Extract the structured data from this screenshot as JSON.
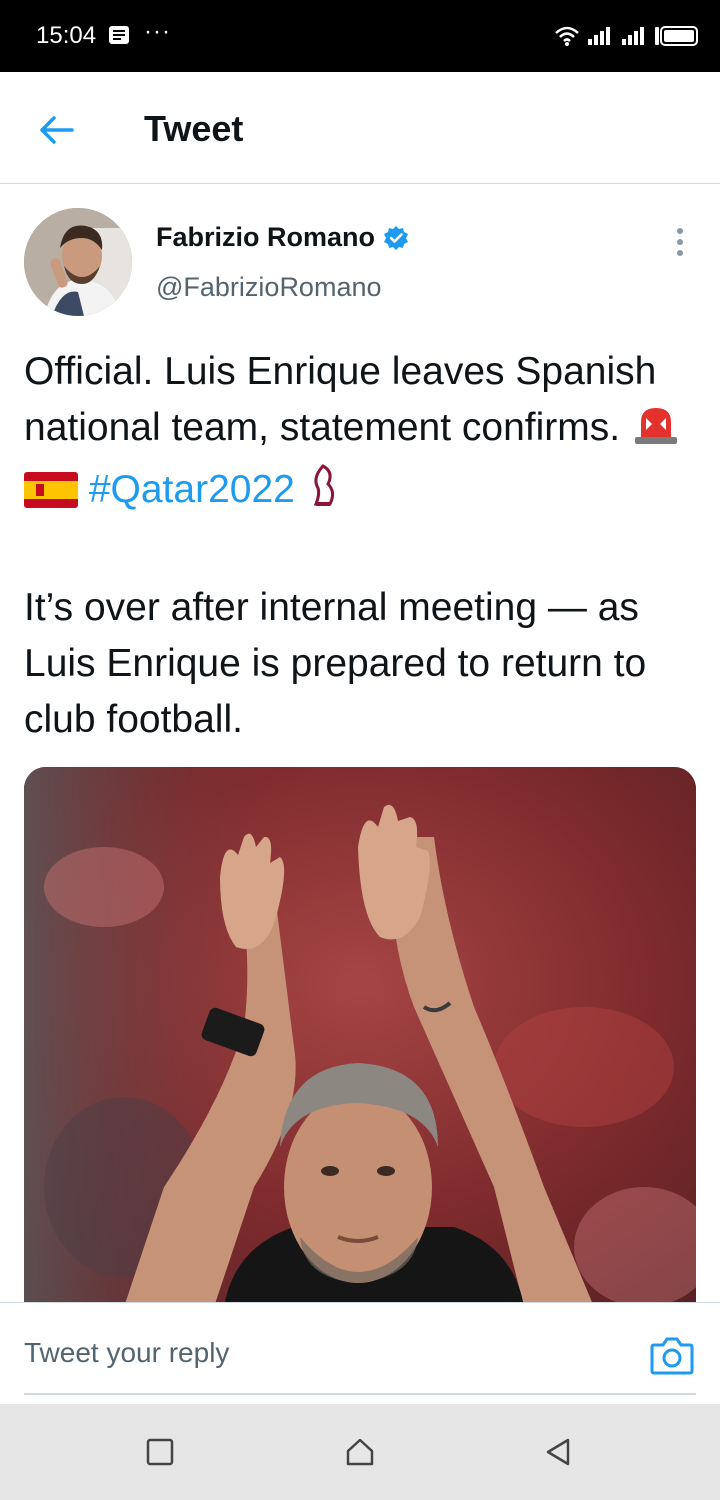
{
  "status_bar": {
    "time": "15:04",
    "more": "···"
  },
  "header": {
    "title": "Tweet"
  },
  "author": {
    "name": "Fabrizio Romano",
    "handle": "@FabrizioRomano",
    "verified": true
  },
  "tweet": {
    "line1": "Official. Luis Enrique leaves Spanish national team, statement confirms.",
    "hashtag": "#Qatar2022",
    "line2": "It’s over after internal meeting — as Luis Enrique is prepared to return to club football."
  },
  "reply": {
    "placeholder": "Tweet your reply"
  },
  "colors": {
    "accent": "#1d9bf0",
    "text": "#0f1419",
    "secondary": "#536471"
  },
  "icons": [
    "back-arrow-icon",
    "verified-badge-icon",
    "more-vertical-icon",
    "camera-icon",
    "siren-icon",
    "spain-flag-icon",
    "world-cup-trophy-icon"
  ]
}
